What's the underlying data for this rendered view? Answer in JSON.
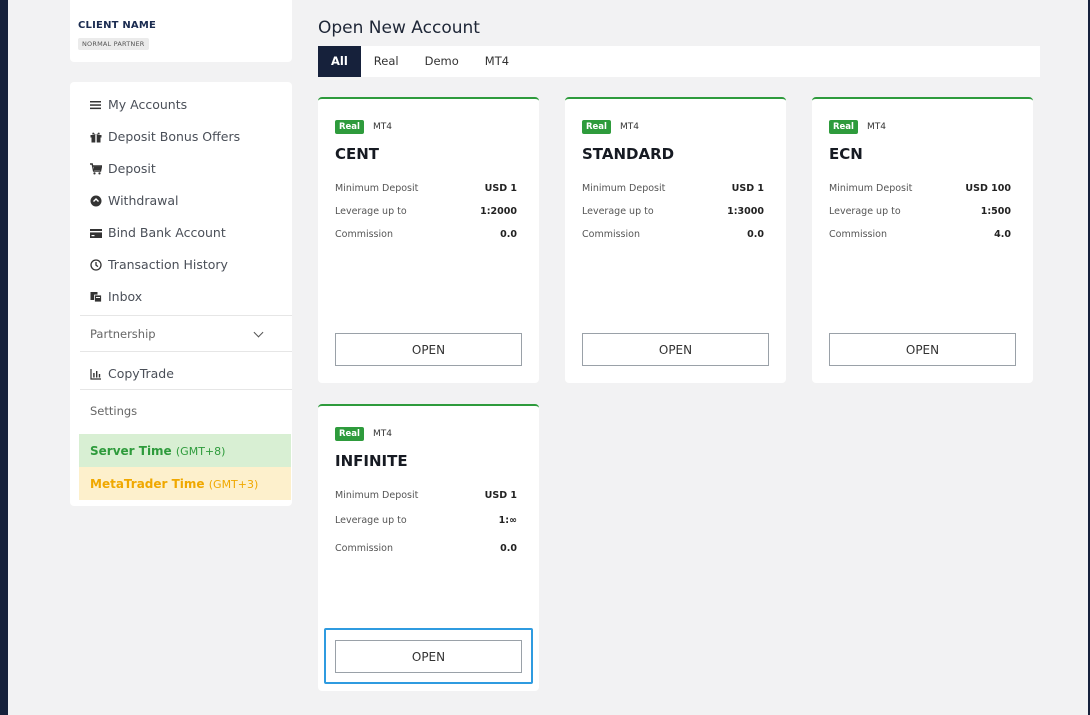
{
  "client": {
    "name": "CLIENT NAME",
    "role": "NORMAL PARTNER"
  },
  "menu": {
    "items": [
      {
        "label": "My Accounts",
        "icon": "list-icon"
      },
      {
        "label": "Deposit Bonus Offers",
        "icon": "gift-icon"
      },
      {
        "label": "Deposit",
        "icon": "cart-icon"
      },
      {
        "label": "Withdrawal",
        "icon": "withdrawal-icon"
      },
      {
        "label": "Bind Bank Account",
        "icon": "card-icon"
      },
      {
        "label": "Transaction History",
        "icon": "clock-icon"
      },
      {
        "label": "Inbox",
        "icon": "inbox-icon"
      }
    ],
    "partnership": "Partnership",
    "copytrade": "CopyTrade",
    "settings": "Settings",
    "server_time": {
      "label": "Server Time",
      "tz": "(GMT+8)"
    },
    "mt_time": {
      "label": "MetaTrader Time",
      "tz": "(GMT+3)"
    }
  },
  "main": {
    "title": "Open New Account",
    "tabs": [
      "All",
      "Real",
      "Demo",
      "MT4"
    ],
    "active_tab": "All"
  },
  "cards": [
    {
      "tag": "Real",
      "platform": "MT4",
      "name": "CENT",
      "rows": [
        [
          "Minimum Deposit",
          "USD 1"
        ],
        [
          "Leverage up to",
          "1:2000"
        ],
        [
          "Commission",
          "0.0"
        ]
      ],
      "button": "OPEN"
    },
    {
      "tag": "Real",
      "platform": "MT4",
      "name": "STANDARD",
      "rows": [
        [
          "Minimum Deposit",
          "USD 1"
        ],
        [
          "Leverage up to",
          "1:3000"
        ],
        [
          "Commission",
          "0.0"
        ]
      ],
      "button": "OPEN"
    },
    {
      "tag": "Real",
      "platform": "MT4",
      "name": "ECN",
      "rows": [
        [
          "Minimum Deposit",
          "USD 100"
        ],
        [
          "Leverage up to",
          "1:500"
        ],
        [
          "Commission",
          "4.0"
        ]
      ],
      "button": "OPEN"
    },
    {
      "tag": "Real",
      "platform": "MT4",
      "name": "INFINITE",
      "rows": [
        [
          "Minimum Deposit",
          "USD 1"
        ],
        [
          "Leverage up to",
          "1:∞"
        ],
        [
          "Commission",
          "0.0"
        ]
      ],
      "button": "OPEN"
    }
  ],
  "colors": {
    "accent_green": "#2e9b3c",
    "nav_dark": "#16213b",
    "highlight_blue": "#2f9be0",
    "mt_orange": "#f0a800"
  }
}
